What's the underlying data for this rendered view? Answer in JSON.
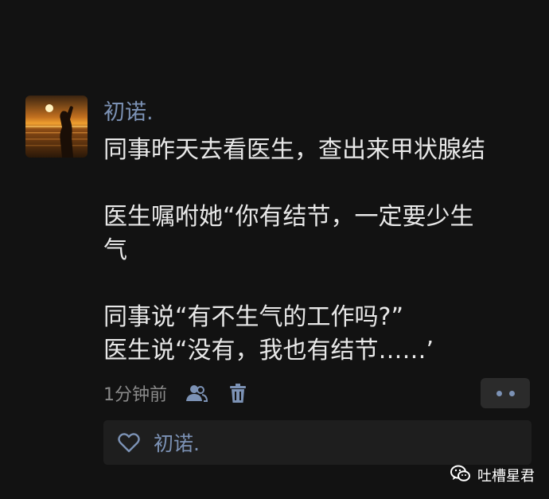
{
  "post": {
    "avatar_icon": "sunset-silhouette-avatar",
    "nickname": "初诺.",
    "content_lines": [
      "同事昨天去看医生，查出来甲状腺结",
      "",
      "医生嘱咐她“你有结节，一定要少生",
      "气",
      "",
      "同事说“有不生气的工作吗?”",
      "医生说“没有，我也有结节……’"
    ],
    "timestamp": "1分钟前",
    "privacy_icon": "people-icon",
    "delete_icon": "trash-icon",
    "more_icon": "more-dots-icon"
  },
  "likes": {
    "icon": "heart-icon",
    "names": "初诺."
  },
  "watermark": {
    "icon": "wechat-official-account-icon",
    "text": "吐槽星君"
  },
  "colors": {
    "background": "#121212",
    "nickname": "#7c92b5",
    "body_text": "#e8e8e8",
    "muted": "#8a8a8a",
    "panel": "#1e1e1e"
  }
}
